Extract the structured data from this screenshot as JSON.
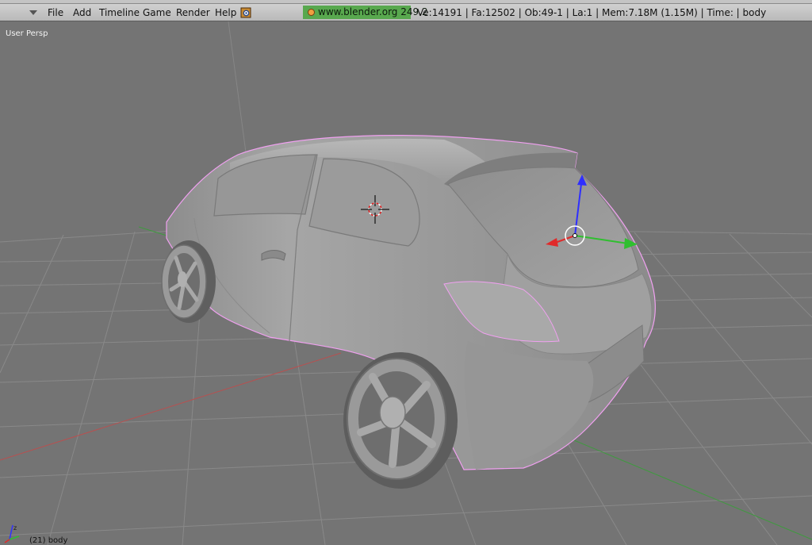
{
  "menubar": {
    "items": [
      {
        "label": "File"
      },
      {
        "label": "Add"
      },
      {
        "label": "Timeline"
      },
      {
        "label": "Game"
      },
      {
        "label": "Render"
      },
      {
        "label": "Help"
      }
    ],
    "version": "www.blender.org 249.2",
    "stats": "Ve:14191 | Fa:12502 | Ob:49-1 | La:1  | Mem:7.18M (1.15M)  | Time: | body"
  },
  "viewport": {
    "view_label": "User Persp",
    "object_label": "(21) body"
  },
  "icons": {
    "menu_toggle": "triangle-down-icon",
    "app": "blender-icon",
    "cursor": "3d-cursor-icon",
    "manipulator": "translate-manipulator-icon",
    "axes": "view-axes-icon"
  },
  "colors": {
    "viewport_bg": "#737373",
    "grid": "#8b8b8b",
    "x_axis": "#c64848",
    "y_axis": "#3f9a3f",
    "z_axis": "#3030ff",
    "selection_outline": "#f0a0f0",
    "version_bg": "#58a84e"
  }
}
